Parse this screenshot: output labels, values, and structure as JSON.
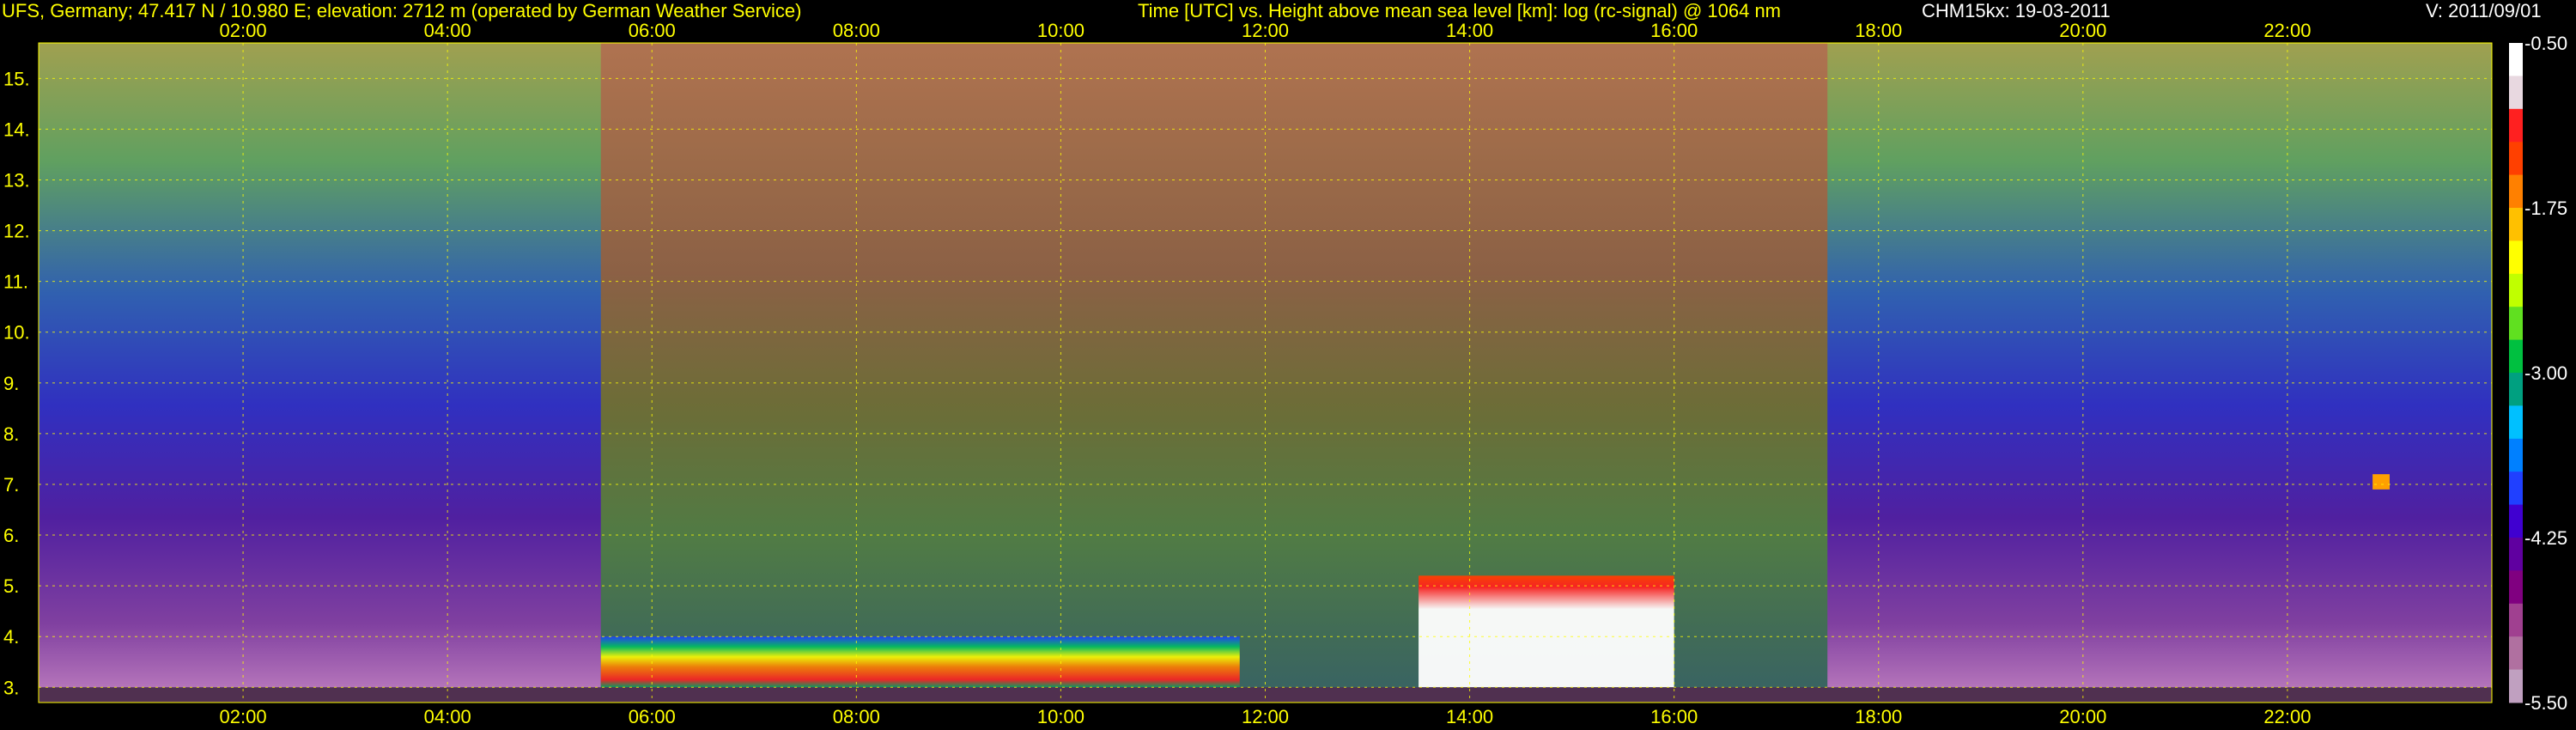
{
  "header": {
    "station": "UFS, Germany; 47.417 N / 10.980 E; elevation: 2712 m  (operated by German Weather Service)",
    "axes_title": "Time [UTC] vs. Height above mean sea level [km]: log (rc-signal) @ 1064 nm",
    "instrument": "CHM15kx: 19-03-2011",
    "version": "V: 2011/09/01"
  },
  "colors": {
    "text": "#ffff00",
    "grid": "#ffff00",
    "cb_label": "#ffffff"
  },
  "chart_data": {
    "type": "heatmap",
    "x": {
      "label": "Time [UTC]",
      "range": [
        "00:00",
        "24:00"
      ],
      "ticks": [
        "02:00",
        "04:00",
        "06:00",
        "08:00",
        "10:00",
        "12:00",
        "14:00",
        "16:00",
        "18:00",
        "20:00",
        "22:00"
      ]
    },
    "y": {
      "label": "Height above mean sea level [km]",
      "range": [
        2.7,
        15.7
      ],
      "ticks": [
        "3.",
        "4.",
        "5.",
        "6.",
        "7.",
        "8.",
        "9.",
        "10.",
        "11.",
        "12.",
        "13.",
        "14.",
        "15."
      ]
    },
    "colorbar": {
      "label": "log (rc-signal)",
      "range": [
        -5.5,
        -0.5
      ],
      "ticks": [
        "-0.50",
        "-1.75",
        "-3.00",
        "-4.25",
        "-5.50"
      ],
      "colors": [
        "#ffffff",
        "#e8d8e0",
        "#ff2020",
        "#ff4000",
        "#ff8000",
        "#ffc000",
        "#ffff00",
        "#c0ff00",
        "#60e020",
        "#00c040",
        "#00a080",
        "#00c0ff",
        "#0080ff",
        "#2040ff",
        "#4000d0",
        "#6000a0",
        "#800080",
        "#a04090",
        "#b070a0",
        "#c0a0c0"
      ]
    },
    "features": [
      {
        "name": "daytime_background_noise",
        "start": "05:30",
        "end": "17:30"
      },
      {
        "name": "boundary_layer_aerosol_morning",
        "start": "05:30",
        "end": "11:45",
        "bottom_km": 3.0,
        "top_km": 4.0
      },
      {
        "name": "low_cloud",
        "start": "13:30",
        "end": "16:00",
        "bottom_km": 3.0,
        "top_km": 5.2
      },
      {
        "name": "elevated_layer",
        "start": "22:50",
        "end": "23:00",
        "bottom_km": 6.9,
        "top_km": 7.2
      }
    ],
    "grid": true
  }
}
